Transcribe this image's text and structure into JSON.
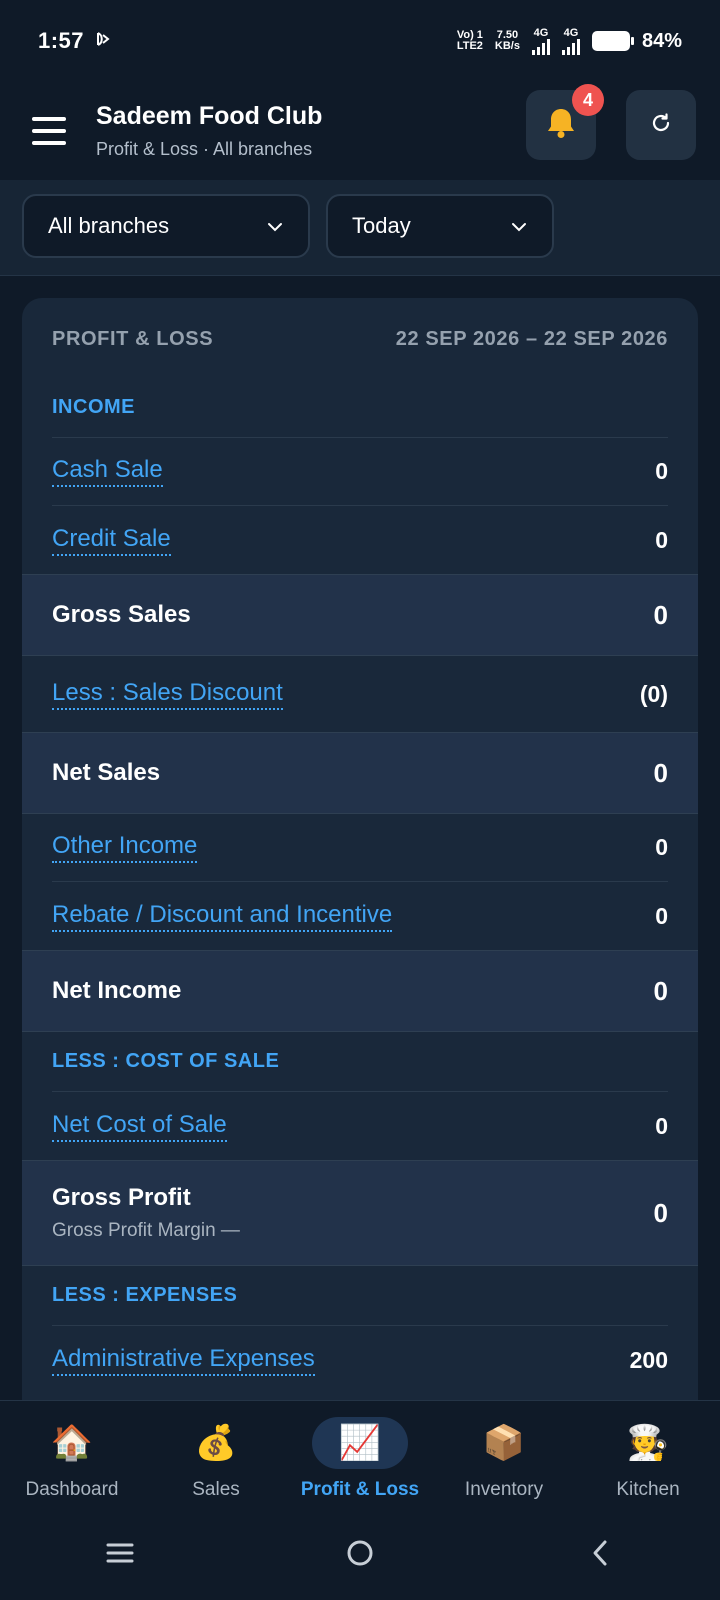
{
  "status_bar": {
    "time": "1:57",
    "net_top": "Vo) 1",
    "net_bottom": "LTE2",
    "speed_top": "7.50",
    "speed_bottom": "KB/s",
    "sim1": "4G",
    "sim2": "4G",
    "battery_pct": "84%"
  },
  "header": {
    "title": "Sadeem Food Club",
    "subtitle": "Profit & Loss · All branches",
    "notification_count": "4"
  },
  "filters": {
    "branch": "All branches",
    "period": "Today"
  },
  "report": {
    "title": "PROFIT & LOSS",
    "date_range": "22 SEP 2026 – 22 SEP 2026",
    "income_label": "INCOME",
    "cash_sale": {
      "label": "Cash Sale",
      "value": "0"
    },
    "credit_sale": {
      "label": "Credit Sale",
      "value": "0"
    },
    "gross_sales": {
      "label": "Gross Sales",
      "value": "0"
    },
    "sales_discount": {
      "label": "Less : Sales Discount",
      "value": "(0)"
    },
    "net_sales": {
      "label": "Net Sales",
      "value": "0"
    },
    "other_income": {
      "label": "Other Income",
      "value": "0"
    },
    "rebate": {
      "label": "Rebate / Discount and Incentive",
      "value": "0"
    },
    "net_income": {
      "label": "Net Income",
      "value": "0"
    },
    "cost_label": "LESS : COST OF SALE",
    "net_cost": {
      "label": "Net Cost of Sale",
      "value": "0"
    },
    "gross_profit": {
      "label": "Gross Profit",
      "sub": "Gross Profit Margin —",
      "value": "0"
    },
    "expenses_label": "LESS : EXPENSES",
    "admin_expenses": {
      "label": "Administrative Expenses",
      "value": "200"
    }
  },
  "nav": {
    "items": [
      {
        "label": "Dashboard",
        "icon": "🏠"
      },
      {
        "label": "Sales",
        "icon": "💰"
      },
      {
        "label": "Profit & Loss",
        "icon": "📈"
      },
      {
        "label": "Inventory",
        "icon": "📦"
      },
      {
        "label": "Kitchen",
        "icon": "🧑‍🍳"
      }
    ]
  },
  "colors": {
    "accent": "#42a5f5",
    "background": "#0f1a28",
    "card": "#19283a",
    "badge": "#ef5350"
  }
}
